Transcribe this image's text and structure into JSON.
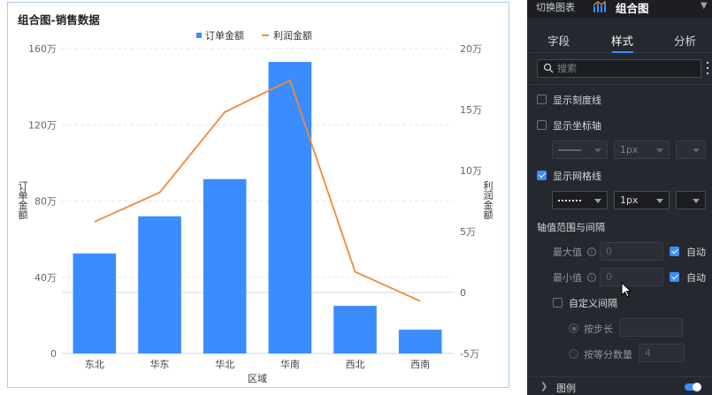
{
  "chart_panel": {
    "title": "组合图-销售数据"
  },
  "chart_data": {
    "type": "bar",
    "title": "组合图-销售数据",
    "categories": [
      "东北",
      "华东",
      "华北",
      "华南",
      "西北",
      "西南"
    ],
    "xlabel": "区域",
    "ylabel": "订单金额",
    "y2label": "利润金额",
    "ylim": [
      0,
      1600000
    ],
    "y2lim": [
      -50000,
      200000
    ],
    "y_ticks": [
      "0",
      "40万",
      "80万",
      "120万",
      "160万"
    ],
    "y2_ticks": [
      "-5万",
      "0",
      "5万",
      "10万",
      "15万",
      "20万"
    ],
    "legend_position": "top-center",
    "grid": true,
    "series": [
      {
        "name": "订单金额",
        "type": "bar",
        "axis": "left",
        "color": "#3b8cff",
        "values": [
          525000,
          720000,
          915000,
          1530000,
          250000,
          125000
        ]
      },
      {
        "name": "利润金额",
        "type": "line",
        "axis": "right",
        "color": "#ee8a3c",
        "values": [
          58000,
          82000,
          148000,
          174000,
          17000,
          -7000
        ]
      }
    ]
  },
  "settings": {
    "switch_chart_label": "切换图表",
    "chart_type_name": "组合图",
    "tabs": [
      {
        "label": "字段",
        "active": false
      },
      {
        "label": "样式",
        "active": true
      },
      {
        "label": "分析",
        "active": false
      }
    ],
    "search_placeholder": "搜索",
    "show_ticks_label": "显示刻度线",
    "show_axis_label": "显示坐标轴",
    "axis_line_width": "1px",
    "show_grid_label": "显示网格线",
    "grid_line_width": "1px",
    "axis_range_title": "轴值范围与间隔",
    "max_label": "最大值",
    "max_value": "0",
    "max_auto_label": "自动",
    "min_label": "最小值",
    "min_value": "0",
    "min_auto_label": "自动",
    "custom_interval_label": "自定义间隔",
    "by_step_label": "按步长",
    "by_count_label": "按等分数量",
    "count_value": "4",
    "legend_label": "图例"
  }
}
